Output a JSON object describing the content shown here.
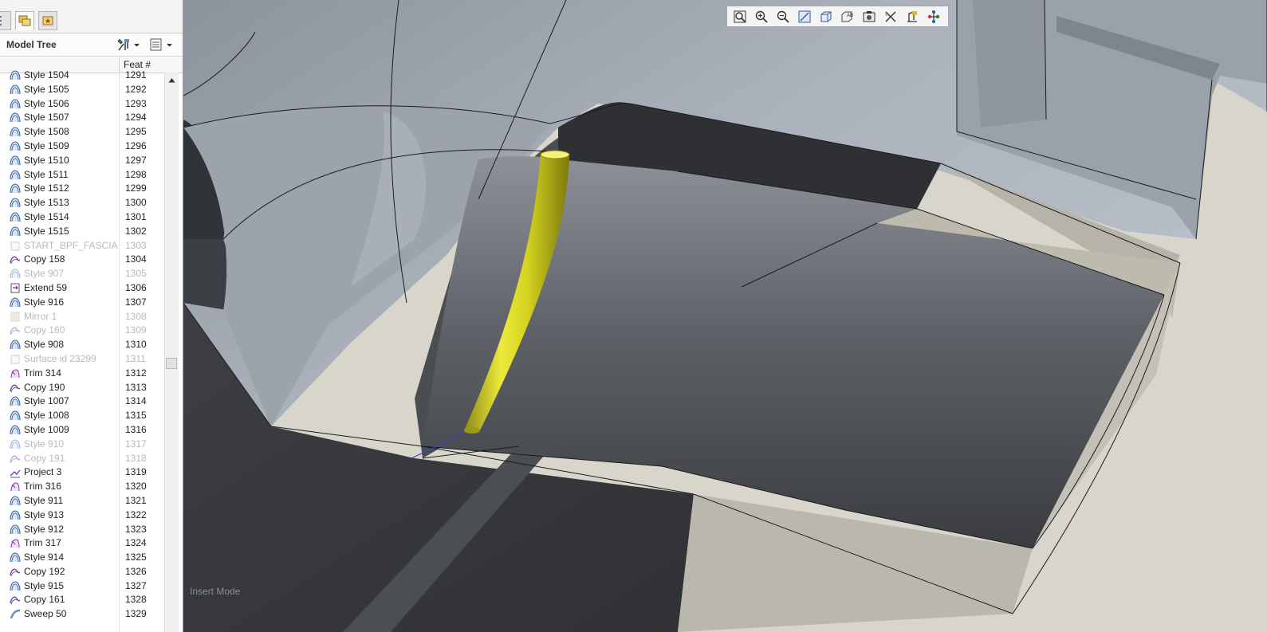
{
  "panel": {
    "title": "Model Tree",
    "column_header": "Feat #"
  },
  "tree_items": [
    {
      "name": "Style 1504",
      "num": "1291",
      "type": "style",
      "dim": false
    },
    {
      "name": "Style 1505",
      "num": "1292",
      "type": "style",
      "dim": false
    },
    {
      "name": "Style 1506",
      "num": "1293",
      "type": "style",
      "dim": false
    },
    {
      "name": "Style 1507",
      "num": "1294",
      "type": "style",
      "dim": false
    },
    {
      "name": "Style 1508",
      "num": "1295",
      "type": "style",
      "dim": false
    },
    {
      "name": "Style 1509",
      "num": "1296",
      "type": "style",
      "dim": false
    },
    {
      "name": "Style 1510",
      "num": "1297",
      "type": "style",
      "dim": false
    },
    {
      "name": "Style 1511",
      "num": "1298",
      "type": "style",
      "dim": false
    },
    {
      "name": "Style 1512",
      "num": "1299",
      "type": "style",
      "dim": false
    },
    {
      "name": "Style 1513",
      "num": "1300",
      "type": "style",
      "dim": false
    },
    {
      "name": "Style 1514",
      "num": "1301",
      "type": "style",
      "dim": false
    },
    {
      "name": "Style 1515",
      "num": "1302",
      "type": "style",
      "dim": false
    },
    {
      "name": "START_BPF_FASCIA",
      "num": "1303",
      "type": "surface",
      "dim": true
    },
    {
      "name": "Copy 158",
      "num": "1304",
      "type": "copy",
      "dim": false
    },
    {
      "name": "Style 907",
      "num": "1305",
      "type": "style",
      "dim": true
    },
    {
      "name": "Extend 59",
      "num": "1306",
      "type": "extend",
      "dim": false
    },
    {
      "name": "Style 916",
      "num": "1307",
      "type": "style",
      "dim": false
    },
    {
      "name": "Mirror 1",
      "num": "1308",
      "type": "mirror",
      "dim": true
    },
    {
      "name": "Copy 160",
      "num": "1309",
      "type": "copy",
      "dim": true
    },
    {
      "name": "Style 908",
      "num": "1310",
      "type": "style",
      "dim": false
    },
    {
      "name": "Surface id 23299",
      "num": "1311",
      "type": "surface",
      "dim": true
    },
    {
      "name": "Trim 314",
      "num": "1312",
      "type": "trim",
      "dim": false
    },
    {
      "name": "Copy 190",
      "num": "1313",
      "type": "copy",
      "dim": false
    },
    {
      "name": "Style 1007",
      "num": "1314",
      "type": "style",
      "dim": false
    },
    {
      "name": "Style 1008",
      "num": "1315",
      "type": "style",
      "dim": false
    },
    {
      "name": "Style 1009",
      "num": "1316",
      "type": "style",
      "dim": false
    },
    {
      "name": "Style 910",
      "num": "1317",
      "type": "style",
      "dim": true
    },
    {
      "name": "Copy 191",
      "num": "1318",
      "type": "copy",
      "dim": true
    },
    {
      "name": "Project 3",
      "num": "1319",
      "type": "project",
      "dim": false
    },
    {
      "name": "Trim 316",
      "num": "1320",
      "type": "trim",
      "dim": false
    },
    {
      "name": "Style 911",
      "num": "1321",
      "type": "style",
      "dim": false
    },
    {
      "name": "Style 913",
      "num": "1322",
      "type": "style",
      "dim": false
    },
    {
      "name": "Style 912",
      "num": "1323",
      "type": "style",
      "dim": false
    },
    {
      "name": "Trim 317",
      "num": "1324",
      "type": "trim",
      "dim": false
    },
    {
      "name": "Style 914",
      "num": "1325",
      "type": "style",
      "dim": false
    },
    {
      "name": "Copy 192",
      "num": "1326",
      "type": "copy",
      "dim": false
    },
    {
      "name": "Style 915",
      "num": "1327",
      "type": "style",
      "dim": false
    },
    {
      "name": "Copy 161",
      "num": "1328",
      "type": "copy",
      "dim": false
    },
    {
      "name": "Sweep 50",
      "num": "1329",
      "type": "sweep",
      "dim": false
    }
  ],
  "toolbar": [
    "refit-icon",
    "zoom-in-icon",
    "zoom-out-icon",
    "repaint-icon",
    "saved-views-icon",
    "annotation-display-icon",
    "view-manager-icon",
    "spin-center-icon",
    "datum-display-icon",
    "network-icon"
  ],
  "viewport": {
    "status_text": "Insert Mode",
    "colors": {
      "background": "#d8d6cb",
      "surface_light": "#a6acb6",
      "surface_dark": "#3e4045",
      "sweep_yellow": "#d4d21e"
    }
  }
}
